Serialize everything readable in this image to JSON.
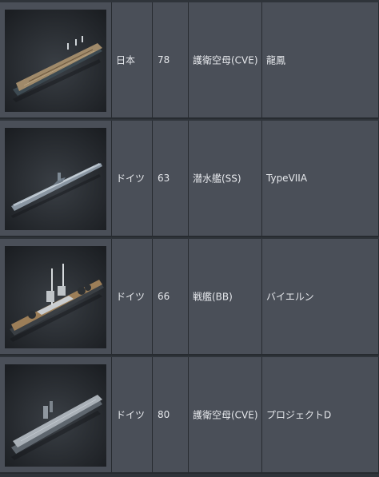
{
  "rows": [
    {
      "thumbnail_icon": "aircraft-carrier-ship-icon",
      "nation": "日本",
      "level": "78",
      "ship_class": "護衛空母(CVE)",
      "ship_name": "龍鳳"
    },
    {
      "thumbnail_icon": "submarine-ship-icon",
      "nation": "ドイツ",
      "level": "63",
      "ship_class": "潜水艦(SS)",
      "ship_name": "TypeVIIA"
    },
    {
      "thumbnail_icon": "battleship-ship-icon",
      "nation": "ドイツ",
      "level": "66",
      "ship_class": "戦艦(BB)",
      "ship_name": "バイエルン"
    },
    {
      "thumbnail_icon": "aircraft-carrier-ship-icon",
      "nation": "ドイツ",
      "level": "80",
      "ship_class": "護衛空母(CVE)",
      "ship_name": "プロジェクトD"
    }
  ]
}
